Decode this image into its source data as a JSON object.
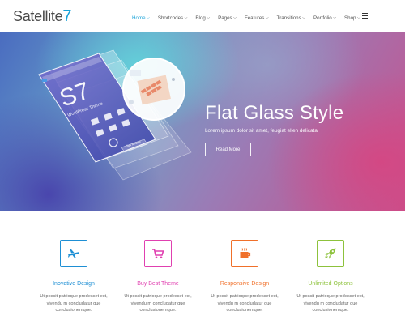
{
  "brand": {
    "name": "Satellite",
    "number": "7"
  },
  "nav": {
    "items": [
      {
        "label": "Home",
        "active": true
      },
      {
        "label": "Shortcodes",
        "active": false
      },
      {
        "label": "Blog",
        "active": false
      },
      {
        "label": "Pages",
        "active": false
      },
      {
        "label": "Features",
        "active": false
      },
      {
        "label": "Transitions",
        "active": false
      },
      {
        "label": "Portfolio",
        "active": false
      },
      {
        "label": "Shop",
        "active": false
      }
    ],
    "menu_icon": "hamburger-icon"
  },
  "hero": {
    "title": "Flat Glass Style",
    "subtitle": "Lorem ipsum dolor sit amet, feugiat ellen delicata",
    "button_label": "Read More",
    "device": {
      "big_text": "S7",
      "small_text": "WordPress Theme",
      "cta": "Get It Now"
    }
  },
  "features": [
    {
      "title": "Inovative Design",
      "text_1": "Ut possit patrioque prodesset est,",
      "text_2": "vivendu m concludatur que",
      "text_3": "conclusionemque.",
      "icon": "plane-icon",
      "color": "#1e8fd4"
    },
    {
      "title": "Buy Best Theme",
      "text_1": "Ut possit patrioque prodesset est,",
      "text_2": "vivendu m concludatur que",
      "text_3": "conclusionemque.",
      "icon": "shopping-cart-icon",
      "color": "#e040b0"
    },
    {
      "title": "Responsive Design",
      "text_1": "Ut possit patrioque prodesset est,",
      "text_2": "vivendu m concludatur que",
      "text_3": "conclusionemque.",
      "icon": "coffee-cup-icon",
      "color": "#f0702a"
    },
    {
      "title": "Unlimited Options",
      "text_1": "Ut possit patrioque prodesset est,",
      "text_2": "vivendu m concludatur que",
      "text_3": "conclusionemque.",
      "icon": "rocket-icon",
      "color": "#8dc23c"
    }
  ],
  "colors": {
    "accent": "#18a2d8",
    "text": "#555555"
  }
}
